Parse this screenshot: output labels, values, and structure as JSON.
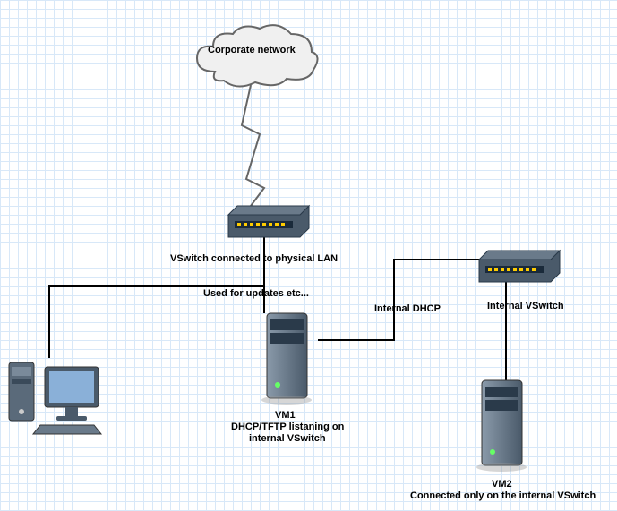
{
  "diagram": {
    "cloud_label": "Corporate network",
    "vswitch1_label": "VSwitch connected to physical LAN",
    "updates_label": "Used for updates etc...",
    "internal_dhcp_label": "Internal DHCP",
    "internal_vswitch_label": "Internal VSwitch",
    "vm1_title": "VM1",
    "vm1_desc1": "DHCP/TFTP listaning on",
    "vm1_desc2": "internal VSwitch",
    "vm2_title": "VM2",
    "vm2_desc": "Connected only on the internal VSwitch"
  }
}
